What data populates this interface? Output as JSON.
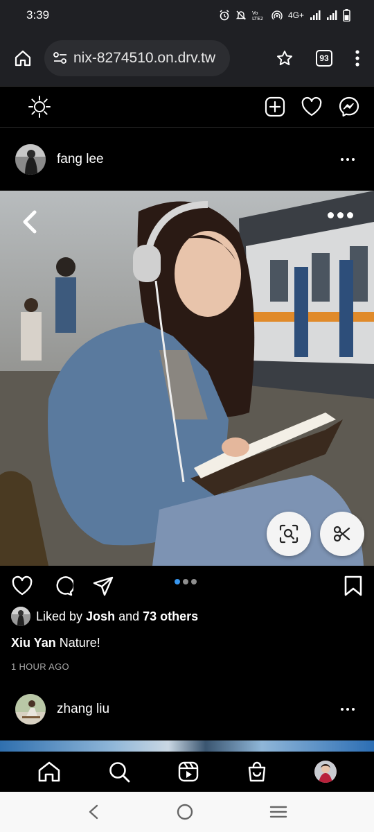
{
  "status_bar": {
    "time": "3:39",
    "network": "4G+"
  },
  "browser": {
    "url": "nix-8274510.on.drv.tw",
    "tab_count": "93"
  },
  "posts": [
    {
      "username": "fang lee",
      "carousel": {
        "total": 3,
        "active_index": 0
      },
      "liked_by_prefix": "Liked by ",
      "liked_by_user": "Josh",
      "liked_by_mid": " and ",
      "liked_by_others": "73 others",
      "caption_user": "Xiu Yan",
      "caption_text": " Nature!",
      "timestamp": "1 HOUR AGO"
    },
    {
      "username": "zhang liu"
    }
  ],
  "icons": {
    "header": [
      "brightness-icon",
      "create-icon",
      "heart-icon",
      "messenger-icon"
    ],
    "bottom_nav": [
      "home-icon",
      "search-icon",
      "reels-icon",
      "shop-icon",
      "profile-avatar"
    ]
  },
  "colors": {
    "accent_blue": "#3897f0",
    "background": "#000000",
    "browser_chrome": "#1f2024"
  }
}
